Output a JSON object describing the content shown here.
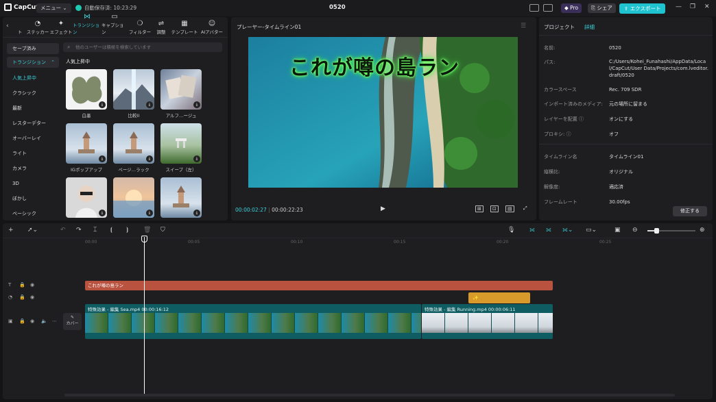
{
  "titlebar": {
    "app_name": "CapCut",
    "menu_label": "メニュー",
    "autosave": "自動保存済: 10:23:29",
    "project_name": "0520",
    "pro_label": "Pro",
    "share_label": "シェア",
    "export_label": "エクスポート"
  },
  "toolbar_tabs": [
    {
      "label": "ステッカー",
      "icon": "sticker-icon",
      "glyph": "◔"
    },
    {
      "label": "エフェクト",
      "icon": "effect-icon",
      "glyph": "✦"
    },
    {
      "label": "トランジション",
      "icon": "transition-icon",
      "glyph": "⋈"
    },
    {
      "label": "キャプション",
      "icon": "caption-icon",
      "glyph": "▭"
    },
    {
      "label": "フィルター",
      "icon": "filter-icon",
      "glyph": "❍"
    },
    {
      "label": "調整",
      "icon": "adjust-icon",
      "glyph": "⇌"
    },
    {
      "label": "テンプレート",
      "icon": "template-icon",
      "glyph": "▦"
    },
    {
      "label": "AIアバター",
      "icon": "ai-avatar-icon",
      "glyph": "☺"
    }
  ],
  "toolbar_left_fragment": "ト",
  "categories": {
    "saved": "セーブ済み",
    "transitions": "トランジション",
    "items": [
      "人気上昇中",
      "クラシック",
      "最新",
      "レスターデター",
      "オーバーレイ",
      "ライト",
      "カメラ",
      "3D",
      "ぼかし",
      "ベーシック"
    ]
  },
  "search_placeholder": "他のユーザーは積極を検索しています",
  "section_title": "人気上昇中",
  "thumbnails": [
    {
      "label": "白墨"
    },
    {
      "label": "比較II"
    },
    {
      "label": "アルフ…ージュ"
    },
    {
      "label": "IGポップアップ"
    },
    {
      "label": "ページ…ラック"
    },
    {
      "label": "スイープ（左）"
    },
    {
      "label": ""
    },
    {
      "label": ""
    },
    {
      "label": ""
    }
  ],
  "viewer": {
    "title": "プレーヤー-タイムライン01",
    "overlay_text": "これが噂の島ラン",
    "current_time": "00:00:02:27",
    "total_time": "00:00:22:23"
  },
  "props": {
    "tab_project": "プロジェクト",
    "tab_detail": "詳細",
    "rows": [
      {
        "label": "名前:",
        "value": "0520"
      },
      {
        "label": "パス:",
        "value": "C:/Users/Kohei_Funahashi/AppData/Local/CapCut/User Data/Projects/com.lveditor.draft/0520"
      },
      {
        "label": "カラースペース",
        "value": "Rec. 709 SDR"
      },
      {
        "label": "インポート済みのメディア:",
        "value": "元の場所に留まる"
      },
      {
        "label": "レイヤーを配置 ⓘ",
        "value": "オンにする"
      },
      {
        "label": "プロキシ: ⓘ",
        "value": "オフ"
      },
      {
        "label": "タイムライン名",
        "value": "タイムライン01"
      },
      {
        "label": "縦横比:",
        "value": "オリジナル"
      },
      {
        "label": "解像度:",
        "value": "適応済"
      },
      {
        "label": "フレームレート",
        "value": "30.00fps"
      }
    ],
    "modify_label": "修正する"
  },
  "timeline": {
    "ticks": [
      "00:00",
      "00:05",
      "00:10",
      "00:15",
      "00:20",
      "00:25"
    ],
    "text_clip": "これが噂の島ラン",
    "sticker_clip": "✨",
    "video_clip_1": "特殊効果 - 編集  Sea.mp4  00:00:16:12",
    "video_clip_2": "特殊効果 - 編集  Running.mp4  00:00:06:11",
    "cover_label": "カバー"
  },
  "colors": {
    "accent": "#3ad0d8",
    "text_clip": "#b9523f",
    "sticker_clip": "#d89a2a",
    "video_clip": "#0f5d62"
  }
}
